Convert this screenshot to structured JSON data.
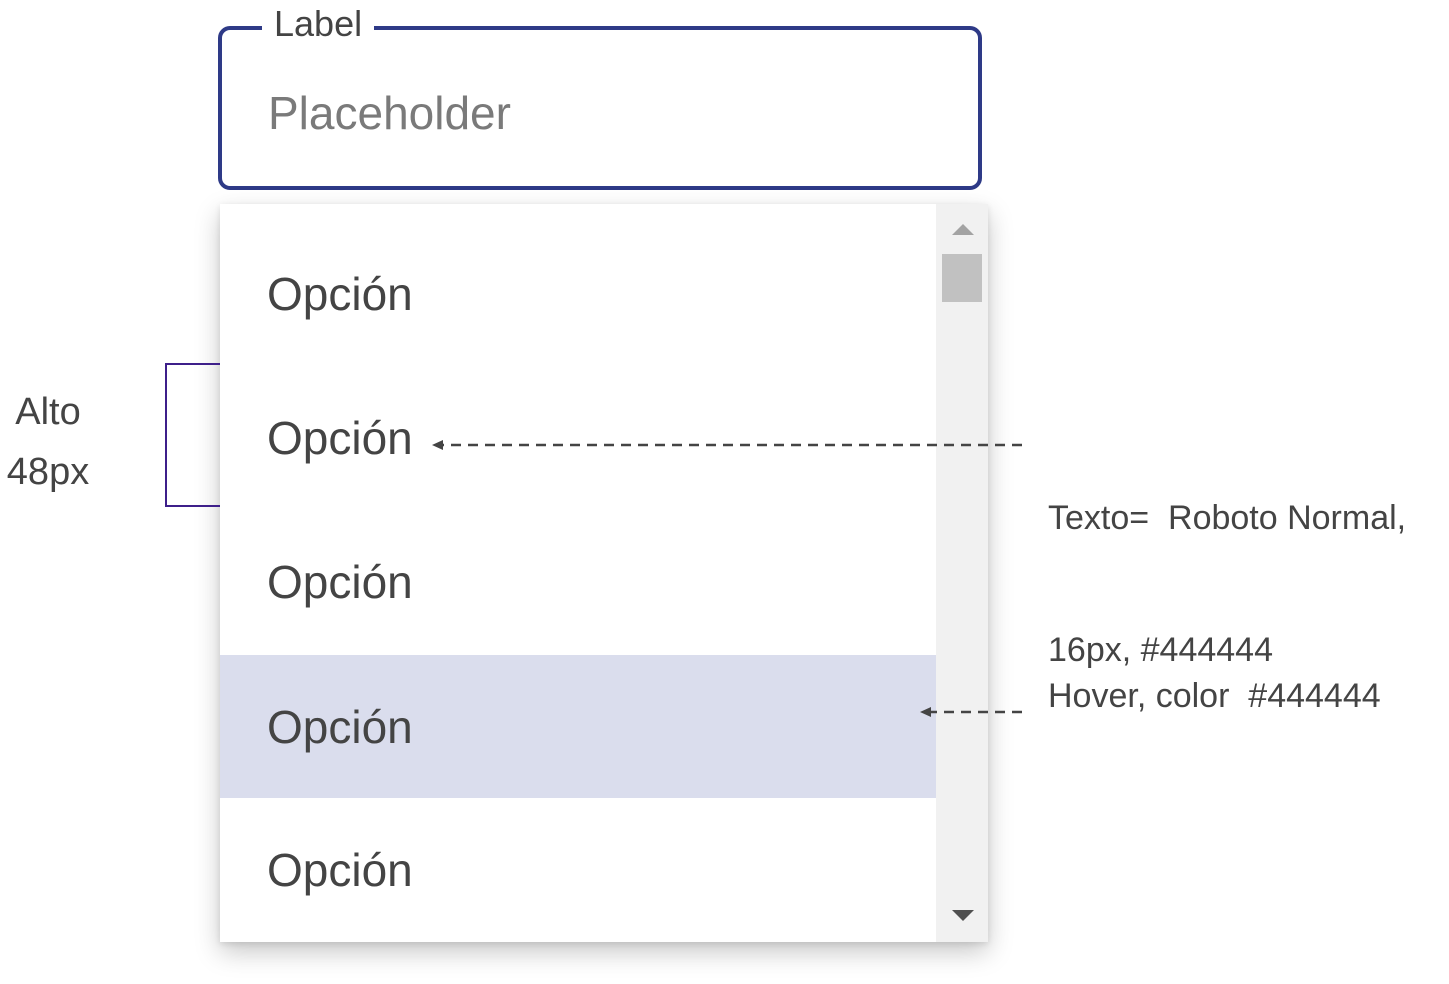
{
  "field": {
    "label": "Label",
    "placeholder": "Placeholder",
    "value": ""
  },
  "menu": {
    "options": [
      {
        "label": "Opción",
        "hovered": false
      },
      {
        "label": "Opción",
        "hovered": false
      },
      {
        "label": "Opción",
        "hovered": false
      },
      {
        "label": "Opción",
        "hovered": true
      },
      {
        "label": "Opción",
        "hovered": false
      }
    ]
  },
  "annotations": {
    "height_line1": "Alto",
    "height_line2": "48px",
    "text_spec_line1": "Texto=  Roboto Normal,",
    "text_spec_line2": "16px, #444444",
    "hover_spec": "Hover, color  #444444"
  },
  "colors": {
    "field_border": "#2e3a87",
    "text": "#444444",
    "placeholder": "#7a7a7a",
    "hover_background": "#dadded",
    "scrollbar_track": "#f1f1f1",
    "scrollbar_thumb": "#c1c1c1",
    "bracket": "#3e1f8a"
  },
  "icons": {
    "scroll_up": "triangle-up-icon",
    "scroll_down": "triangle-down-icon",
    "annotation_arrow": "arrow-left-icon"
  }
}
